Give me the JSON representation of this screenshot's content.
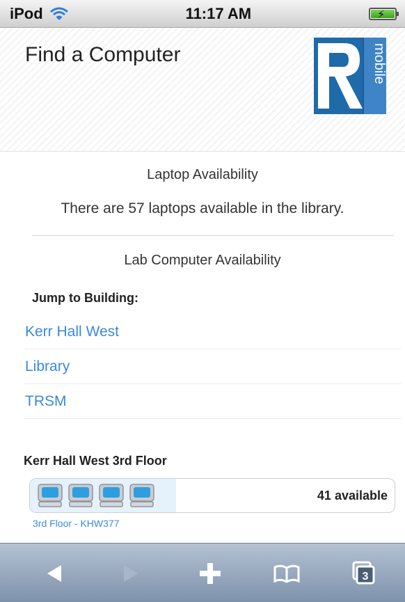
{
  "status_bar": {
    "carrier": "iPod",
    "time": "11:17 AM",
    "icons": [
      "wifi-icon",
      "battery-charging-icon"
    ]
  },
  "header": {
    "title": "Find a Computer",
    "logo": {
      "letter": "R",
      "word": "mobile",
      "colors": {
        "primary": "#1d5d99",
        "light": "#3e84c6"
      }
    }
  },
  "laptops": {
    "heading": "Laptop Availability",
    "message": "There are 57 laptops available in the library."
  },
  "labs": {
    "heading": "Lab Computer Availability",
    "jump_label": "Jump to Building:",
    "buildings": [
      "Kerr Hall West",
      "Library",
      "TRSM"
    ]
  },
  "floor": {
    "title": "Kerr Hall West 3rd Floor",
    "available_label": "41 available",
    "available_fraction": 0.4,
    "computer_icons": 4,
    "room_link": "3rd Floor - KHW377"
  },
  "toolbar": {
    "buttons": [
      "back-icon",
      "forward-icon",
      "add-bookmark-icon",
      "bookmarks-icon",
      "pages-icon"
    ],
    "pages_count": "3"
  },
  "colors": {
    "link": "#3a8ad8",
    "toolbar": "#8fa2bb"
  }
}
